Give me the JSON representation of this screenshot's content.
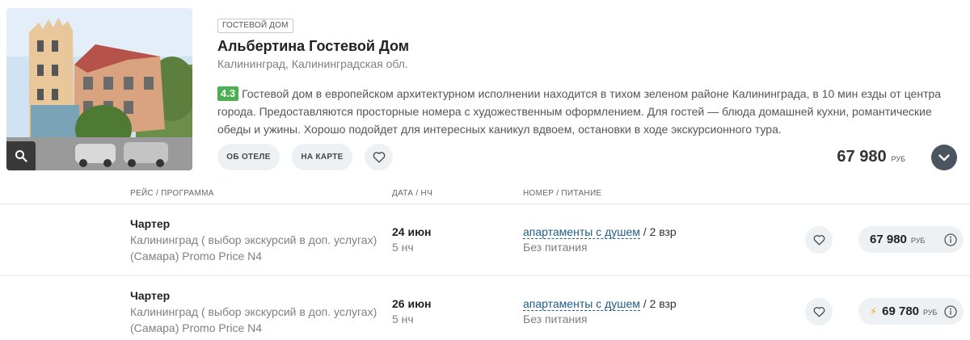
{
  "hotel": {
    "type_badge": "ГОСТЕВОЙ ДОМ",
    "name": "Альбертина Гостевой Дом",
    "location": "Калининград, Калининградская обл.",
    "rating": "4.3",
    "description": "Гостевой дом в европейском архитектурном исполнении находится в тихом зеленом районе Калининграда, в 10 мин езды от центра города. Предоставляются просторные номера с художественным оформлением. Для гостей — блюда домашней кухни, романтические обеды и ужины. Хорошо подойдет для интересных каникул вдвоем, остановки в ходе экскурсионного тура.",
    "photo_icon": "search-icon"
  },
  "actions": {
    "about_label": "ОБ ОТЕЛЕ",
    "map_label": "НА КАРТЕ",
    "favorite_icon": "heart-icon",
    "expand_icon": "chevron-down-icon"
  },
  "main_price": {
    "amount": "67 980",
    "currency": "РУБ"
  },
  "columns": {
    "flight": "РЕЙС / ПРОГРАММА",
    "date": "ДАТА / НЧ",
    "room": "НОМЕР / ПИТАНИЕ"
  },
  "offers": [
    {
      "flight_type": "Чартер",
      "route_line1": "Калининград ( выбор экскурсий в доп. услугах)",
      "route_line2": "(Самара) Promo Price N4",
      "date": "24 июн",
      "nights": "5 нч",
      "room_link": "апартаменты с душем",
      "occupancy": "/ 2 взр",
      "meal": "Без питания",
      "price": "67 980",
      "currency": "РУБ",
      "bolt": ""
    },
    {
      "flight_type": "Чартер",
      "route_line1": "Калининград ( выбор экскурсий в доп. услугах)",
      "route_line2": "(Самара) Promo Price N4",
      "date": "26 июн",
      "nights": "5 нч",
      "room_link": "апартаменты с душем",
      "occupancy": "/ 2 взр",
      "meal": "Без питания",
      "price": "69 780",
      "currency": "РУБ",
      "bolt": "⚡"
    }
  ],
  "colors": {
    "rating_green": "#4caf50",
    "link_blue": "#1f5c8b",
    "bolt_orange": "#f5a623",
    "button_bg": "#eef1f4",
    "expand_bg": "#4a5560"
  }
}
